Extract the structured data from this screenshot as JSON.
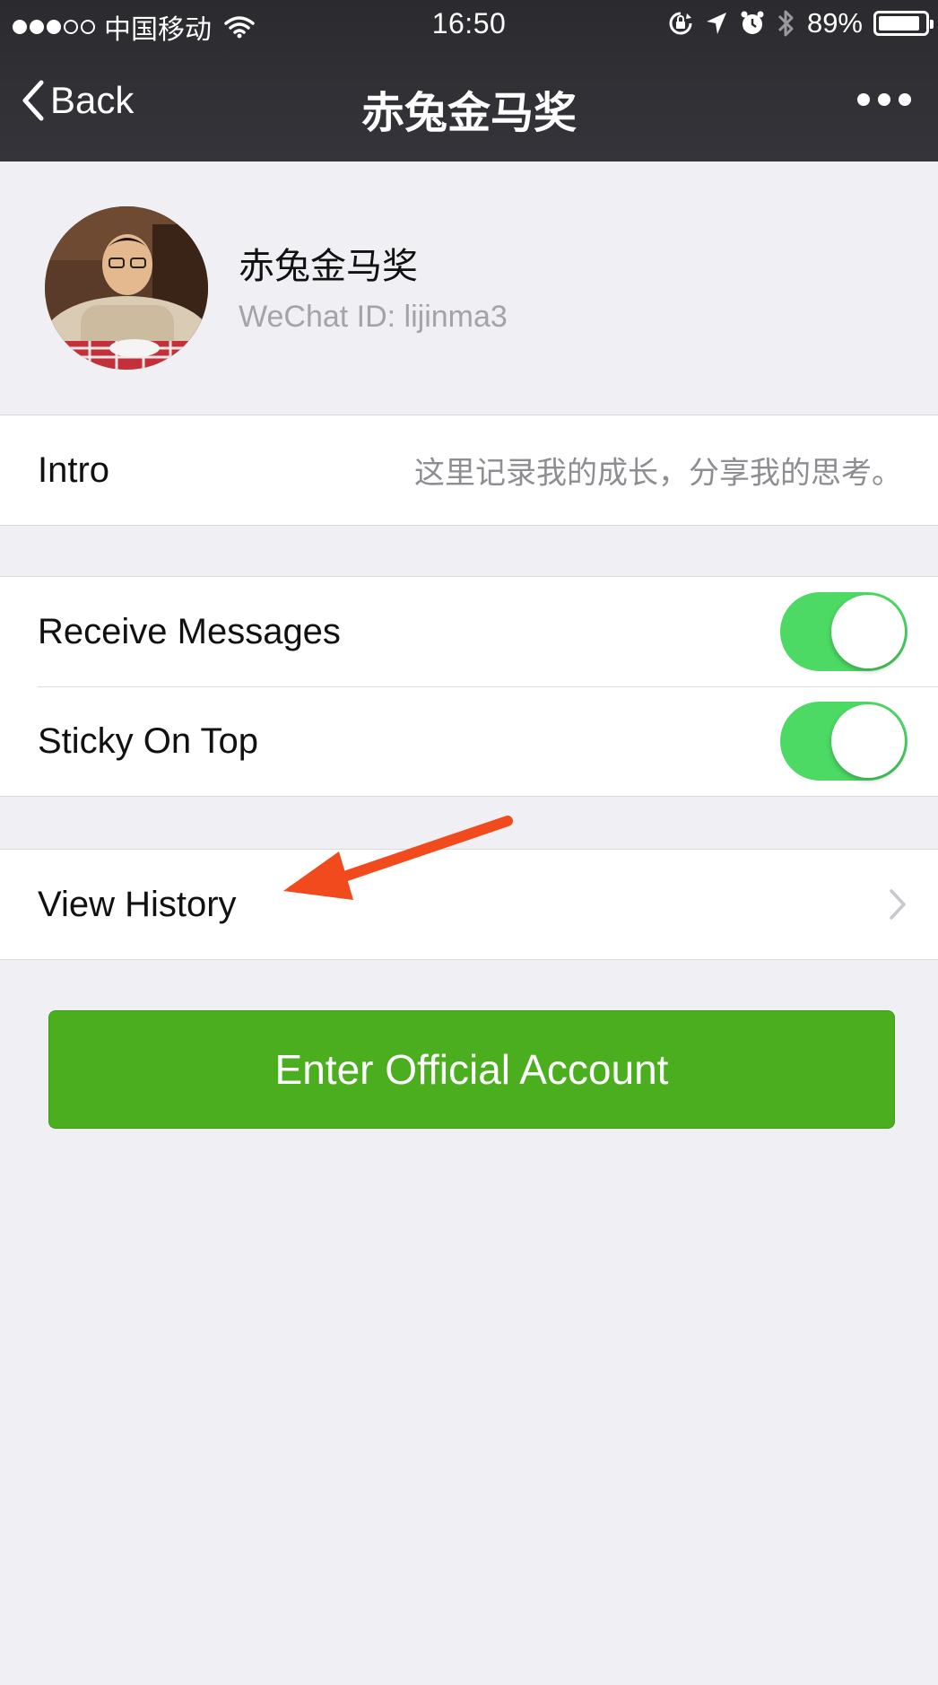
{
  "status_bar": {
    "carrier": "中国移动",
    "time": "16:50",
    "battery_percent": "89%",
    "battery_level": 0.89,
    "signal_bars_filled": 3,
    "signal_bars_total": 5
  },
  "navbar": {
    "back_label": "Back",
    "title": "赤兔金马奖",
    "more_icon": "more-dots-icon"
  },
  "profile": {
    "name": "赤兔金马奖",
    "wechat_id": "WeChat ID: lijinma3"
  },
  "intro": {
    "label": "Intro",
    "value": "这里记录我的成长，分享我的思考。"
  },
  "settings": {
    "receive_messages": {
      "label": "Receive Messages",
      "enabled": true
    },
    "sticky_on_top": {
      "label": "Sticky On Top",
      "enabled": true
    }
  },
  "history": {
    "label": "View History"
  },
  "enter_button": {
    "label": "Enter Official Account"
  },
  "colors": {
    "nav_bg": "#2b2b2f",
    "page_bg": "#efeff4",
    "toggle_on": "#4cd964",
    "primary_button": "#4bae1f",
    "annotation_arrow": "#f04a1d"
  }
}
